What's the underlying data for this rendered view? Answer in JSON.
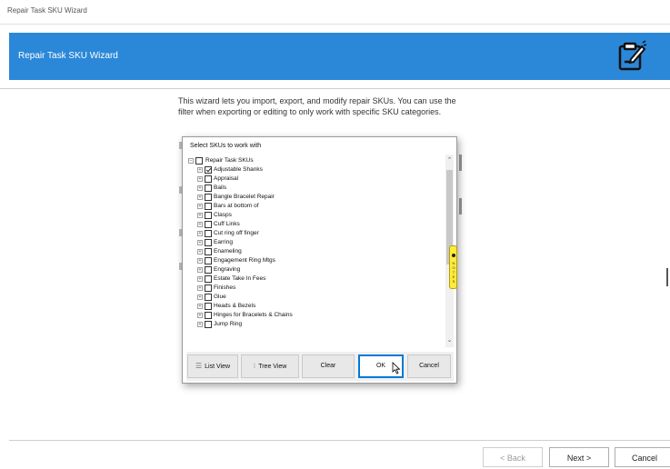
{
  "window": {
    "title": "Repair Task SKU Wizard"
  },
  "banner": {
    "title": "Repair Task SKU Wizard",
    "icon": "clipboard-edit-icon",
    "color": "#2b88d8"
  },
  "intro": {
    "text": "This wizard lets you import, export, and modify repair SKUs. You can use the filter when exporting or editing to only work with specific SKU categories."
  },
  "dialog": {
    "title": "Select SKUs to work with",
    "tree": {
      "root": {
        "label": "Repair Task SKUs",
        "checked": false
      },
      "items": [
        {
          "label": "Adjustable Shanks",
          "checked": true
        },
        {
          "label": "Appraisal",
          "checked": false
        },
        {
          "label": "Bails",
          "checked": false
        },
        {
          "label": "Bangle Bracelet Repair",
          "checked": false
        },
        {
          "label": "Bars at bottom of",
          "checked": false
        },
        {
          "label": "Clasps",
          "checked": false
        },
        {
          "label": "Cuff Links",
          "checked": false
        },
        {
          "label": "Cut ring off finger",
          "checked": false
        },
        {
          "label": "Earring",
          "checked": false
        },
        {
          "label": "Enameling",
          "checked": false
        },
        {
          "label": "Engagement Ring Mtgs",
          "checked": false
        },
        {
          "label": "Engraving",
          "checked": false
        },
        {
          "label": "Estate Take In Fees",
          "checked": false
        },
        {
          "label": "Finishes",
          "checked": false
        },
        {
          "label": "Glue",
          "checked": false
        },
        {
          "label": "Heads & Bezels",
          "checked": false
        },
        {
          "label": "Hinges for Bracelets & Chains",
          "checked": false
        },
        {
          "label": "Jump Ring",
          "checked": false
        }
      ]
    },
    "buttons": {
      "list_view": "List View",
      "tree_view": "Tree View",
      "clear": "Clear",
      "ok": "OK",
      "cancel": "Cancel"
    },
    "side_tab_text": "N O T E S"
  },
  "footer": {
    "back": "< Back",
    "next": "Next >",
    "cancel": "Cancel"
  }
}
